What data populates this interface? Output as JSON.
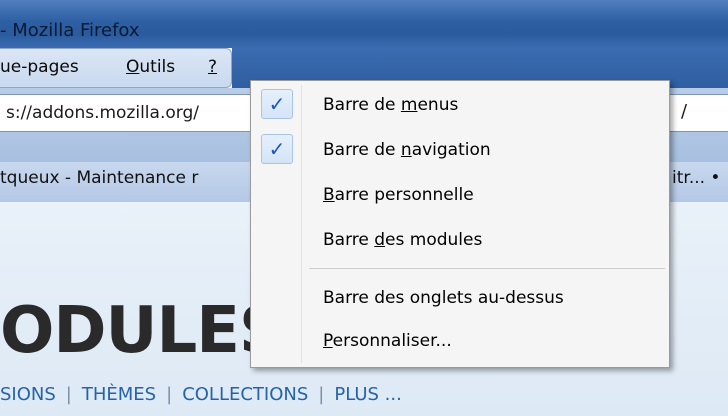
{
  "window": {
    "title": "- Mozilla Firefox"
  },
  "menubar": {
    "items": [
      {
        "pre": "ue-pages",
        "acc": "",
        "post": ""
      },
      {
        "pre": "",
        "acc": "O",
        "post": "utils"
      },
      {
        "pre": "",
        "acc": "?",
        "post": ""
      }
    ]
  },
  "navbar": {
    "url_text": "s://addons.mozilla.org/",
    "right_glyph": "/"
  },
  "tabs": [
    {
      "label": "tqueux - Maintenance r"
    },
    {
      "label": "itr... •"
    }
  ],
  "page": {
    "heading": "ODULES",
    "subnav": [
      "SIONS",
      "THÈMES",
      "COLLECTIONS",
      "PLUS ..."
    ]
  },
  "context_menu": {
    "items": [
      {
        "pre": "Barre de ",
        "acc": "m",
        "post": "enus",
        "checked": true
      },
      {
        "pre": "Barre de ",
        "acc": "n",
        "post": "avigation",
        "checked": true
      },
      {
        "pre": "",
        "acc": "B",
        "post": "arre personnelle",
        "checked": false
      },
      {
        "pre": "Barre ",
        "acc": "d",
        "post": "es modules",
        "checked": false
      },
      {
        "pre": "Barre des onglets au-dessus",
        "acc": "",
        "post": "",
        "checked": false
      },
      {
        "pre": "",
        "acc": "P",
        "post": "ersonnaliser...",
        "checked": false
      }
    ],
    "check_glyph": "✓"
  },
  "colors": {
    "titlebar": "#2d5fa3",
    "menubar": "#dbe6f5",
    "link": "#2563a8",
    "check": "#1f57b8"
  }
}
